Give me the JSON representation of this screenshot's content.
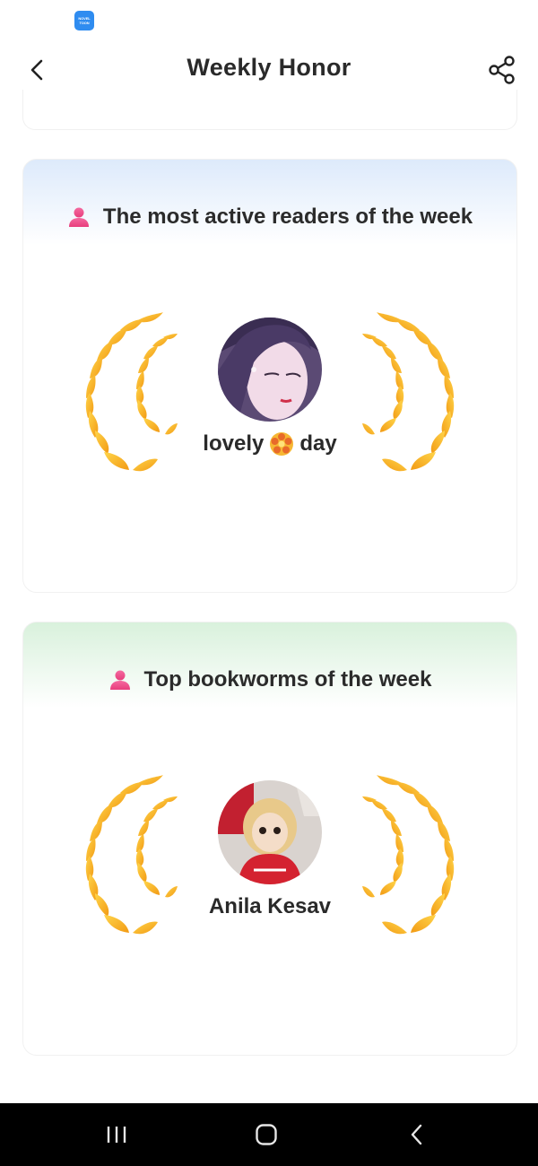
{
  "status_bar": {
    "app_icon_label": "NOVEL TOON"
  },
  "header": {
    "title": "Weekly Honor"
  },
  "sections": [
    {
      "title": "The most active readers of the week",
      "user_name_part1": "lovely",
      "user_name_part2": "day",
      "accent": "#ddeafb"
    },
    {
      "title": "Top bookworms of the week",
      "user_name": "Anila Kesav",
      "accent": "#d9f1dc"
    }
  ],
  "colors": {
    "person_icon": "#f0508a",
    "laurel_gold": "#f7b81c",
    "laurel_orange": "#f08a16",
    "nav_background": "#000000"
  },
  "icons": [
    "back-arrow-icon",
    "share-icon",
    "person-icon",
    "laurel-icon",
    "flower-emoji-icon",
    "recent-apps-icon",
    "home-icon",
    "back-nav-icon"
  ]
}
